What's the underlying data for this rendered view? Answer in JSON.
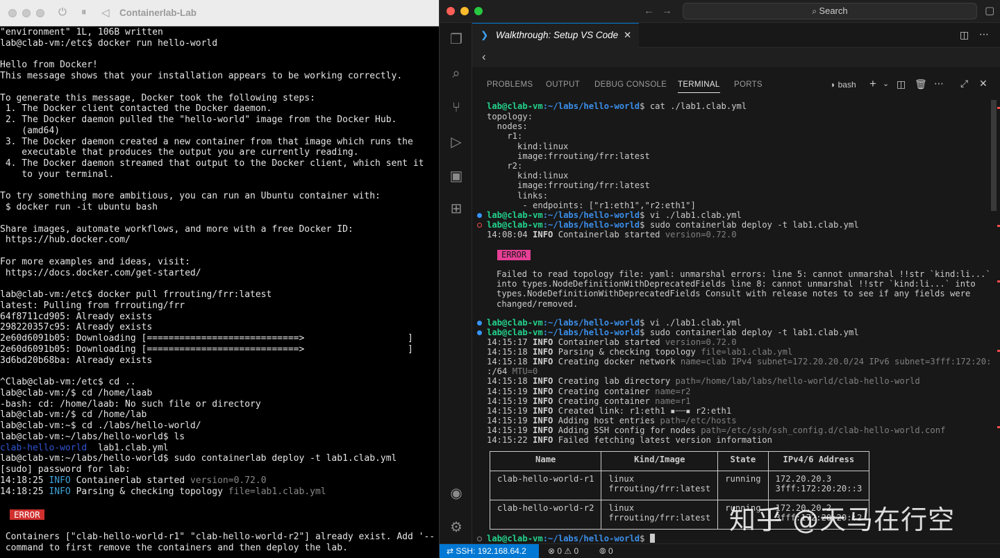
{
  "left": {
    "title": "Containerlab-Lab",
    "lines": [
      "\"environment\" 1L, 106B written",
      "lab@clab-vm:/etc$ docker run hello-world",
      "",
      "Hello from Docker!",
      "This message shows that your installation appears to be working correctly.",
      "",
      "To generate this message, Docker took the following steps:",
      " 1. The Docker client contacted the Docker daemon.",
      " 2. The Docker daemon pulled the \"hello-world\" image from the Docker Hub.",
      "    (amd64)",
      " 3. The Docker daemon created a new container from that image which runs the",
      "    executable that produces the output you are currently reading.",
      " 4. The Docker daemon streamed that output to the Docker client, which sent it",
      "    to your terminal.",
      "",
      "To try something more ambitious, you can run an Ubuntu container with:",
      " $ docker run -it ubuntu bash",
      "",
      "Share images, automate workflows, and more with a free Docker ID:",
      " https://hub.docker.com/",
      "",
      "For more examples and ideas, visit:",
      " https://docs.docker.com/get-started/",
      "",
      "lab@clab-vm:/etc$ docker pull frrouting/frr:latest",
      "latest: Pulling from frrouting/frr",
      "64f8711cd905: Already exists",
      "298220357c95: Already exists",
      "2e60d6091b05: Downloading [============================>                   ]",
      "2e60d6091b05: Downloading [============================>                   ]",
      "3d6bd20b68ba: Already exists",
      "",
      "^Clab@clab-vm:/etc$ cd ..",
      "lab@clab-vm:/$ cd /home/laab",
      "-bash: cd: /home/laab: No such file or directory",
      "lab@clab-vm:/$ cd /home/lab",
      "lab@clab-vm:~$ cd ./labs/hello-world/",
      "lab@clab-vm:~/labs/hello-world$ ls"
    ],
    "ls_dir": "clab-hello-world",
    "ls_file": "  lab1.clab.yml",
    "lines2": [
      "lab@clab-vm:~/labs/hello-world$ sudo containerlab deploy -t lab1.clab.yml",
      "[sudo] password for lab:"
    ],
    "log1_time": "14:18:25",
    "log1_level": "INFO",
    "log1_msg": " Containerlab started ",
    "log1_kv": "version=0.72.0",
    "log2_msg": " Parsing & checking topology ",
    "log2_kv": "file=lab1.clab.yml",
    "error_label": "ERROR",
    "err_line1": " Containers [\"clab-hello-world-r1\" \"clab-hello-world-r2\"] already exist. Add '--",
    "err_line2": " command to first remove the containers and then deploy the lab."
  },
  "right": {
    "search": "Search",
    "tab_title": "Walkthrough: Setup VS Code",
    "panel_tabs": [
      "PROBLEMS",
      "OUTPUT",
      "DEBUG CONSOLE",
      "TERMINAL",
      "PORTS"
    ],
    "shell": "bash",
    "prompt": "lab@clab-vm",
    "path": ":~/labs/hello-world",
    "cmd1": "$ cat ./lab1.clab.yml",
    "yaml": [
      "topology:",
      "  nodes:",
      "    r1:",
      "      kind:linux",
      "      image:frrouting/frr:latest",
      "    r2:",
      "      kind:linux",
      "      image:frrouting/frr:latest",
      "      links:",
      "       - endpoints: [\"r1:eth1\",\"r2:eth1\"]"
    ],
    "cmd2": "$ vi ./lab1.clab.yml",
    "cmd3": "$ sudo containerlab deploy -t lab1.clab.yml",
    "log_a": {
      "time": "14:08:04",
      "level": "INFO",
      "msg": " Containerlab started ",
      "kv": "version=0.72.0"
    },
    "error_label": "ERROR",
    "error_lines": [
      "Failed to read topology file: yaml: unmarshal errors: line 5: cannot unmarshal !!str `kind:li...`",
      "into types.NodeDefinitionWithDeprecatedFields line 8: cannot unmarshal !!str `kind:li...` into",
      "types.NodeDefinitionWithDeprecatedFields Consult with release notes to see if any fields were",
      "changed/removed."
    ],
    "cmd4": "$ vi ./lab1.clab.yml",
    "cmd5": "$ sudo containerlab deploy -t lab1.clab.yml",
    "logs": [
      {
        "time": "14:15:17",
        "level": "INFO",
        "msg": " Containerlab started ",
        "kv": "version=0.72.0",
        "msg2": ""
      },
      {
        "time": "14:15:18",
        "level": "INFO",
        "msg": " Parsing & checking topology ",
        "kv": "file=lab1.clab.yml",
        "msg2": ""
      },
      {
        "time": "14:15:18",
        "level": "INFO",
        "msg": " Creating docker network ",
        "kv": "name=clab IPv4 subnet=172.20.20.0/24 IPv6 subnet=3fff:172:20:20:",
        "msg2": ""
      },
      {
        "time": "",
        "level": "",
        "msg": ":/64 ",
        "kv": "MTU=0",
        "msg2": ""
      },
      {
        "time": "14:15:18",
        "level": "INFO",
        "msg": " Creating lab directory ",
        "kv": "path=/home/lab/labs/hello-world/clab-hello-world",
        "msg2": ""
      },
      {
        "time": "14:15:19",
        "level": "INFO",
        "msg": " Creating container ",
        "kv": "name=r2",
        "msg2": ""
      },
      {
        "time": "14:15:19",
        "level": "INFO",
        "msg": " Creating container ",
        "kv": "name=r1",
        "msg2": ""
      },
      {
        "time": "14:15:19",
        "level": "INFO",
        "msg": " Created link: r1:eth1 ▪┄┄▪ r2:eth1",
        "kv": "",
        "msg2": ""
      },
      {
        "time": "14:15:19",
        "level": "INFO",
        "msg": " Adding host entries ",
        "kv": "path=/etc/hosts",
        "msg2": ""
      },
      {
        "time": "14:15:19",
        "level": "INFO",
        "msg": " Adding SSH config for nodes ",
        "kv": "path=/etc/ssh/ssh_config.d/clab-hello-world.conf",
        "msg2": ""
      },
      {
        "time": "14:15:22",
        "level": "INFO",
        "msg": " Failed fetching latest version information",
        "kv": "",
        "msg2": ""
      }
    ],
    "table": {
      "headers": [
        "Name",
        "Kind/Image",
        "State",
        "IPv4/6 Address"
      ],
      "rows": [
        [
          "clab-hello-world-r1",
          "linux\nfrrouting/frr:latest",
          "running",
          "172.20.20.3\n3fff:172:20:20::3"
        ],
        [
          "clab-hello-world-r2",
          "linux\nfrrouting/frr:latest",
          "running",
          "172.20.20.2\n3fff:172:20:20::2"
        ]
      ]
    },
    "final_prompt": "$ ",
    "status": {
      "ssh": "SSH: 192.168.64.2",
      "errors": "0",
      "warnings": "0",
      "ports": "0"
    }
  },
  "watermark": "知乎 @天马在行空"
}
